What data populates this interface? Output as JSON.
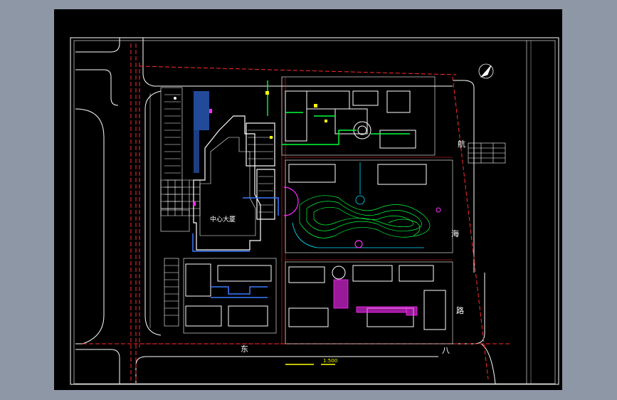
{
  "drawing": {
    "background_color": "#000000",
    "surround_color": "#8e97a6",
    "colors": {
      "road": "#ffffff",
      "red_line": "#ff2b2b",
      "building": "#ffffff",
      "green": "#00ff3c",
      "magenta": "#ff2bff",
      "blue": "#3a7bff",
      "cyan": "#00e5ff",
      "yellow": "#ffff00"
    },
    "north_arrow_icon": "north-arrow-icon"
  },
  "labels": {
    "center_building": "中心大厦",
    "road_east_top": "航",
    "road_east_mid": "海",
    "road_east_low": "路",
    "road_south_a": "东",
    "road_south_b": "八",
    "scale": "1:500"
  }
}
